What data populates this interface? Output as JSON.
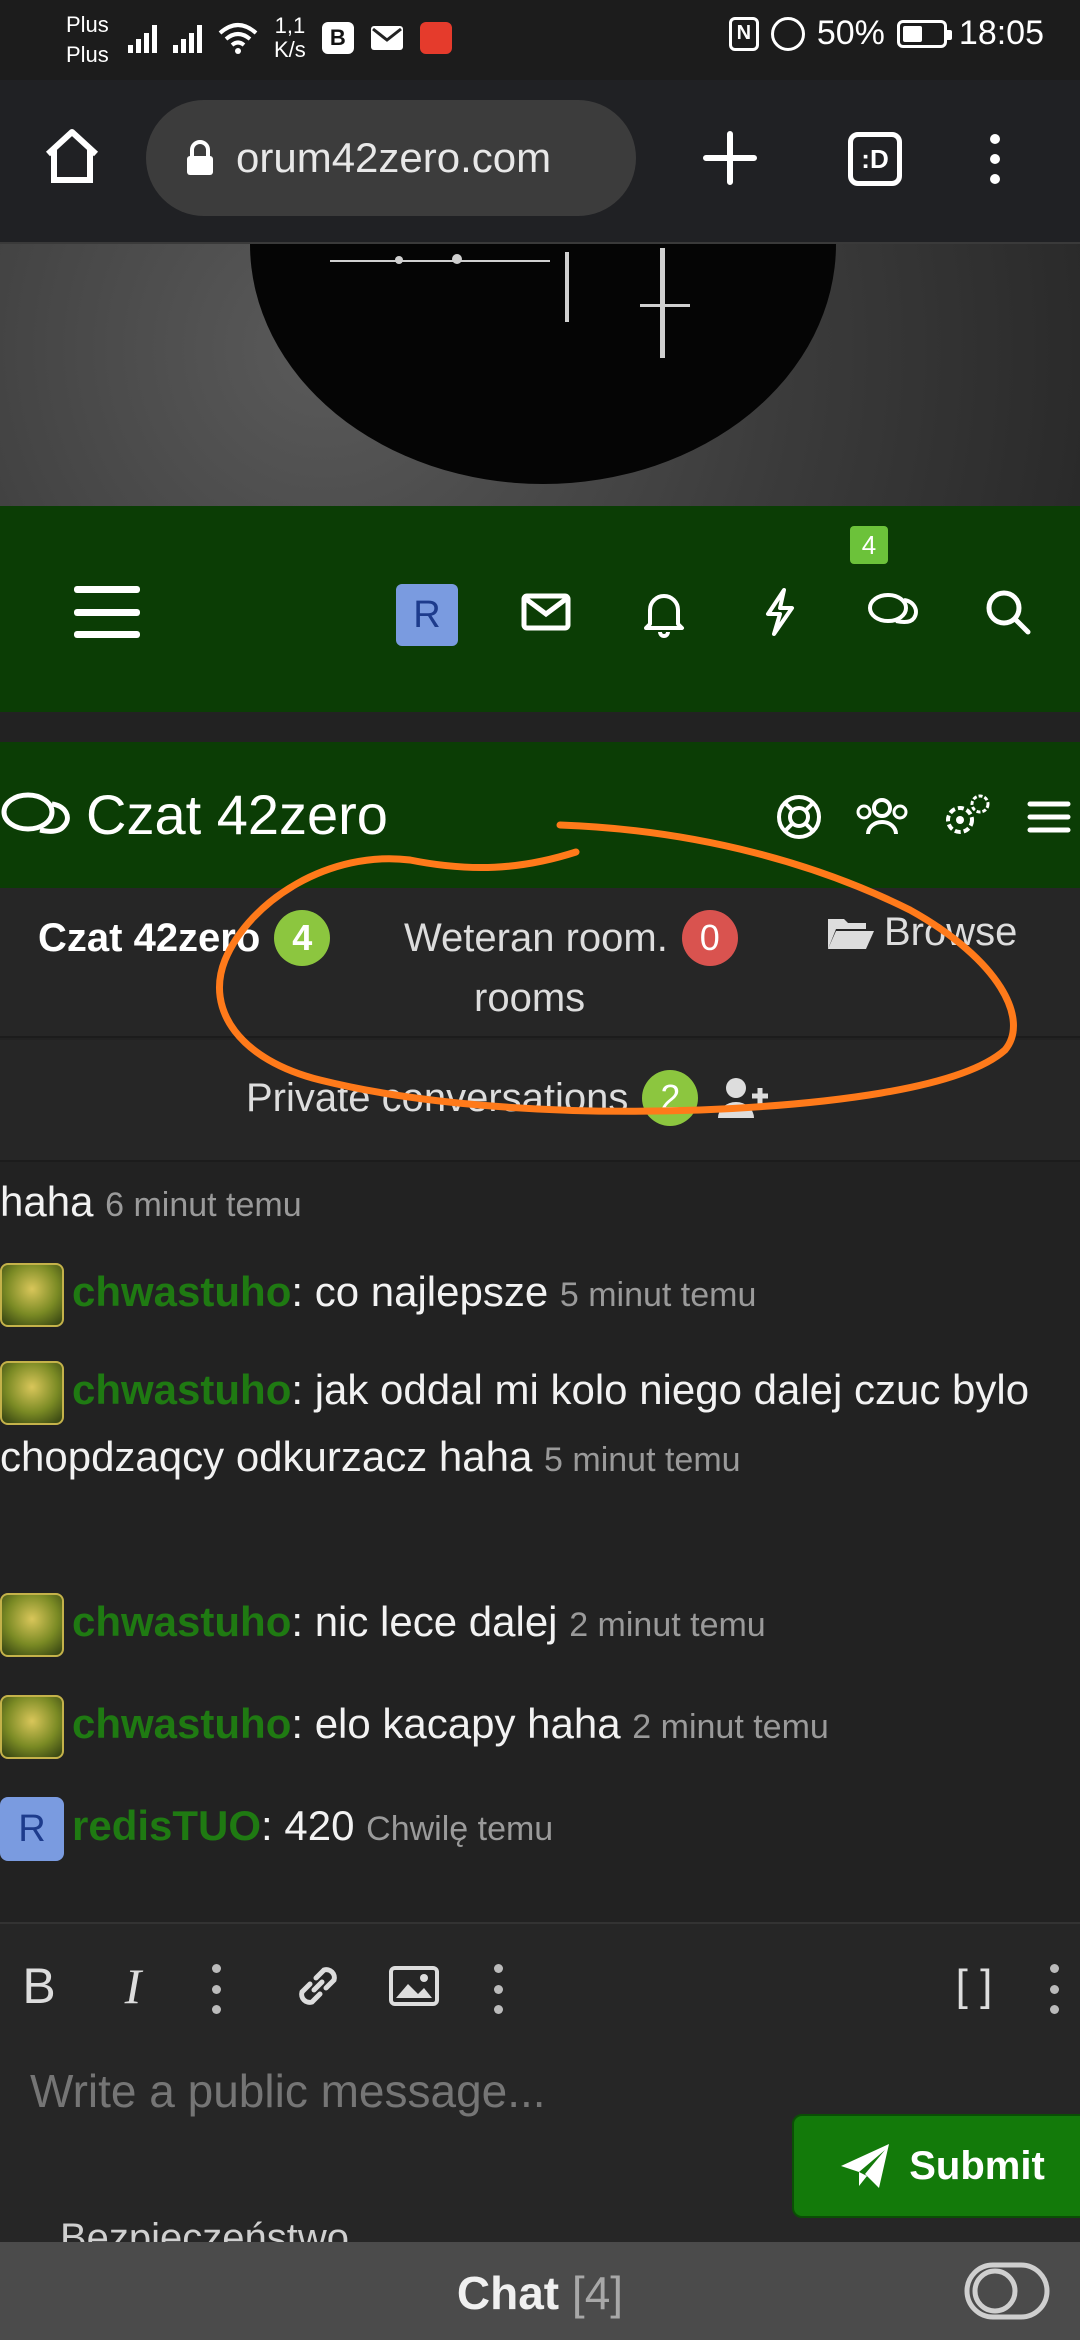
{
  "status_bar": {
    "carrier_line1": "Plus",
    "carrier_line2": "Plus",
    "speed_value": "1,1",
    "speed_unit": "K/s",
    "battery": "50%",
    "time": "18:05"
  },
  "browser": {
    "url": "orum42zero.com",
    "tabs_label": ":D"
  },
  "forum_nav": {
    "avatar_letter": "R",
    "chat_badge": "4"
  },
  "chat": {
    "title": "Czat 42zero",
    "rooms": [
      {
        "name": "Czat 42zero",
        "count": "4",
        "active": true
      },
      {
        "name": "Weteran room.",
        "count": "0",
        "active": false
      }
    ],
    "browse_label_1": "Browse",
    "browse_label_2": "rooms",
    "private_label": "Private conversations",
    "private_count": "2"
  },
  "messages": [
    {
      "user": "",
      "text": "haha",
      "time": "6 minut temu"
    },
    {
      "user": "chwastuho",
      "text": ": co najlepsze",
      "time": "5 minut temu"
    },
    {
      "user": "chwastuho",
      "text": ": jak oddal mi kolo niego dalej czuc bylo chopdzaqcy odkurzacz haha",
      "time": "5 minut temu"
    },
    {
      "user": "chwastuho",
      "text": ": nic lece dalej",
      "time": "2 minut temu"
    },
    {
      "user": "chwastuho",
      "text": ": elo kacapy haha",
      "time": "2 minut temu"
    },
    {
      "user": "redisTUO",
      "text": ": 420",
      "time": "Chwilę temu",
      "avatar_letter": "R"
    }
  ],
  "editor": {
    "bold": "B",
    "italic": "I",
    "code": "[ ]",
    "placeholder": "Write a public message...",
    "submit_label": "Submit"
  },
  "cutoff_text": "Bezpieczeństwo",
  "bottom_bar": {
    "label": "Chat",
    "count": "[4]"
  },
  "colors": {
    "forum_green": "#0b3d05",
    "user_green": "#1f7a12",
    "badge_green": "#8cc63f",
    "badge_red": "#d9534f",
    "annotation_orange": "#ff7a1a"
  }
}
